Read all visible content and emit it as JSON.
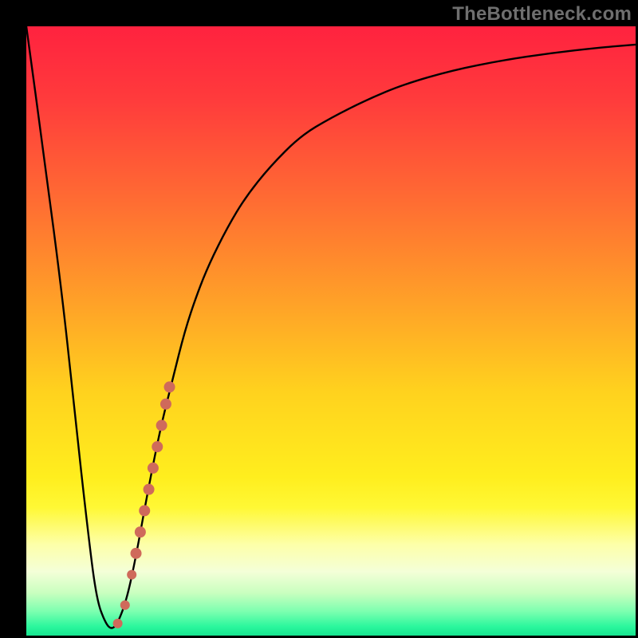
{
  "watermark": "TheBottleneck.com",
  "colors": {
    "frame": "#000000",
    "watermark": "#6f6f6f",
    "curve": "#000000",
    "marker_fill": "#cf6a5b",
    "marker_stroke": "#b85a4d",
    "gradient_stops": [
      {
        "offset": 0.0,
        "color": "#ff223f"
      },
      {
        "offset": 0.12,
        "color": "#ff3b3c"
      },
      {
        "offset": 0.28,
        "color": "#ff6a33"
      },
      {
        "offset": 0.45,
        "color": "#ffa028"
      },
      {
        "offset": 0.6,
        "color": "#ffd21e"
      },
      {
        "offset": 0.74,
        "color": "#ffee1e"
      },
      {
        "offset": 0.79,
        "color": "#fff835"
      },
      {
        "offset": 0.85,
        "color": "#fdffa8"
      },
      {
        "offset": 0.895,
        "color": "#f4ffd8"
      },
      {
        "offset": 0.93,
        "color": "#c9ffbf"
      },
      {
        "offset": 0.96,
        "color": "#7dffb0"
      },
      {
        "offset": 0.985,
        "color": "#2bf79d"
      },
      {
        "offset": 1.0,
        "color": "#18e590"
      }
    ]
  },
  "chart_data": {
    "type": "line",
    "title": "",
    "xlabel": "",
    "ylabel": "",
    "xlim": [
      0,
      100
    ],
    "ylim": [
      0,
      100
    ],
    "series": [
      {
        "name": "bottleneck-curve",
        "x": [
          0,
          3,
          6,
          8,
          10,
          11.5,
          13,
          14,
          15,
          16.5,
          18,
          20,
          22,
          24,
          26,
          28,
          30,
          33,
          36,
          40,
          45,
          50,
          56,
          62,
          70,
          78,
          86,
          94,
          100
        ],
        "y": [
          100,
          78,
          55,
          36,
          18,
          6,
          2,
          1,
          2,
          6,
          13,
          24,
          34,
          42,
          50,
          56,
          61,
          67,
          72,
          77,
          82,
          85,
          88,
          90.5,
          92.8,
          94.4,
          95.6,
          96.5,
          97
        ]
      }
    ],
    "markers": [
      {
        "x": 15.0,
        "y": 2.0,
        "r": 6
      },
      {
        "x": 16.2,
        "y": 5.0,
        "r": 6
      },
      {
        "x": 17.3,
        "y": 10.0,
        "r": 6
      },
      {
        "x": 18.0,
        "y": 13.5,
        "r": 7
      },
      {
        "x": 18.7,
        "y": 17.0,
        "r": 7
      },
      {
        "x": 19.4,
        "y": 20.5,
        "r": 7
      },
      {
        "x": 20.1,
        "y": 24.0,
        "r": 7
      },
      {
        "x": 20.8,
        "y": 27.5,
        "r": 7
      },
      {
        "x": 21.5,
        "y": 31.0,
        "r": 7
      },
      {
        "x": 22.2,
        "y": 34.5,
        "r": 7
      },
      {
        "x": 22.9,
        "y": 38.0,
        "r": 7
      },
      {
        "x": 23.5,
        "y": 40.8,
        "r": 7
      }
    ]
  }
}
